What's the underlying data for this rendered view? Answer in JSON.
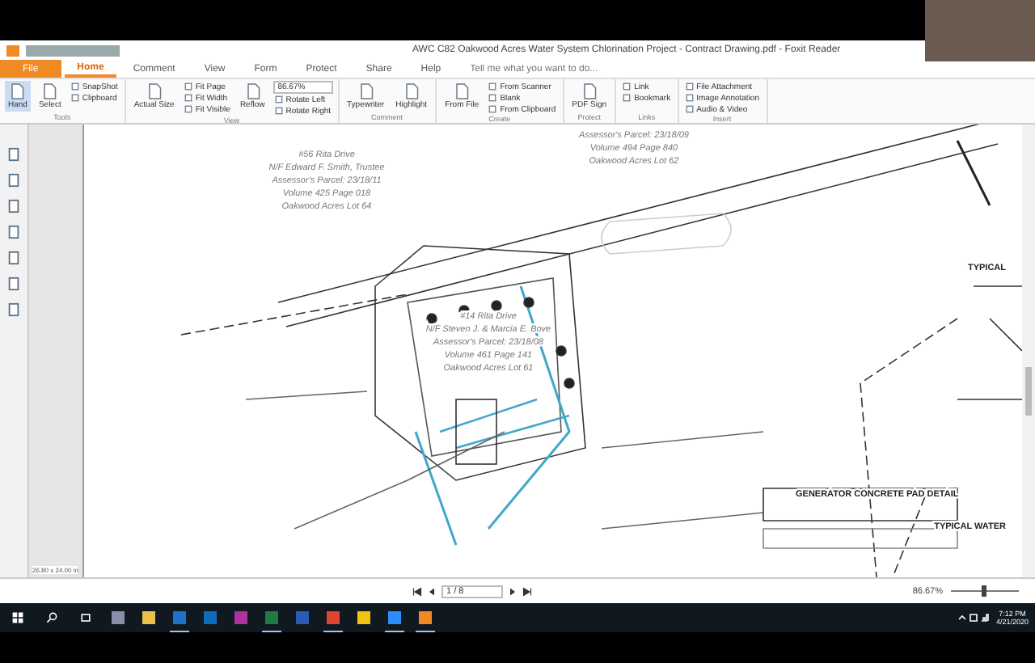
{
  "window": {
    "title": "AWC C82 Oakwood Acres Water System Chlorination Project - Contract Drawing.pdf - Foxit Reader"
  },
  "tabs": [
    {
      "label": "File",
      "selected": false,
      "kind": "file"
    },
    {
      "label": "Home",
      "selected": true,
      "kind": "tab"
    },
    {
      "label": "Comment",
      "selected": false,
      "kind": "tab"
    },
    {
      "label": "View",
      "selected": false,
      "kind": "tab"
    },
    {
      "label": "Form",
      "selected": false,
      "kind": "tab"
    },
    {
      "label": "Protect",
      "selected": false,
      "kind": "tab"
    },
    {
      "label": "Share",
      "selected": false,
      "kind": "tab"
    },
    {
      "label": "Help",
      "selected": false,
      "kind": "tab"
    }
  ],
  "search": {
    "placeholder": "Tell me what you want to do..."
  },
  "ribbon": [
    {
      "label": "Tools",
      "items": [
        {
          "kind": "large",
          "label": "Hand",
          "selected": true
        },
        {
          "kind": "large",
          "label": "Select",
          "selected": false
        },
        {
          "kind": "stack",
          "labels": [
            "SnapShot",
            "Clipboard"
          ]
        }
      ]
    },
    {
      "label": "View",
      "items": [
        {
          "kind": "large",
          "label": "Actual Size",
          "selected": false
        },
        {
          "kind": "stack",
          "labels": [
            "Fit Page",
            "Fit Width",
            "Fit Visible"
          ]
        },
        {
          "kind": "large",
          "label": "Reflow",
          "selected": false
        },
        {
          "kind": "zoom",
          "value": "86.67%",
          "labels": [
            "Rotate Left",
            "Rotate Right"
          ]
        }
      ]
    },
    {
      "label": "Comment",
      "items": [
        {
          "kind": "large",
          "label": "Typewriter",
          "selected": false
        },
        {
          "kind": "large",
          "label": "Highlight",
          "selected": false
        }
      ]
    },
    {
      "label": "Create",
      "items": [
        {
          "kind": "large",
          "label": "From File",
          "selected": false
        },
        {
          "kind": "stack",
          "labels": [
            "From Scanner",
            "Blank",
            "From Clipboard"
          ]
        }
      ]
    },
    {
      "label": "Protect",
      "items": [
        {
          "kind": "large",
          "label": "PDF Sign",
          "selected": false
        }
      ]
    },
    {
      "label": "Links",
      "items": [
        {
          "kind": "stack",
          "labels": [
            "Link",
            "Bookmark"
          ]
        }
      ]
    },
    {
      "label": "Insert",
      "items": [
        {
          "kind": "stack",
          "labels": [
            "File Attachment",
            "Image Annotation",
            "Audio & Video"
          ]
        }
      ]
    }
  ],
  "drawing_labels": [
    {
      "lines": [
        "#56 Rita Drive",
        "N/F Edward F. Smith, Trustee",
        "Assessor's Parcel: 23/18/11",
        "Volume 425 Page 018",
        "Oakwood Acres Lot 64"
      ]
    },
    {
      "lines": [
        "Assessor's Parcel: 23/18/09",
        "Volume 494 Page 840",
        "Oakwood Acres Lot 62"
      ]
    },
    {
      "lines": [
        "#14 Rita Drive",
        "N/F Steven J. & Marcia E. Bove",
        "Assessor's Parcel: 23/18/08",
        "Volume 461 Page 141",
        "Oakwood Acres Lot 61"
      ]
    },
    {
      "lines": [
        "GENERATOR CONCRETE PAD DETAIL"
      ]
    },
    {
      "lines": [
        "TYPICAL"
      ]
    },
    {
      "lines": [
        "TYPICAL WATER"
      ]
    }
  ],
  "page_size": "26.80 x 24.00 in",
  "status_bar": {
    "page": "1 / 8",
    "zoom": "86.67%",
    "zoom_level": {
      "level": 0.45
    }
  },
  "taskbar": {
    "apps": [
      {
        "color": "#8a8fa8",
        "running": false
      },
      {
        "color": "#e8c24a",
        "running": false
      },
      {
        "color": "#1e73c8",
        "running": true
      },
      {
        "color": "#0f6cbd",
        "running": false
      },
      {
        "color": "#b1309f",
        "running": false
      },
      {
        "color": "#1f7a44",
        "running": true
      },
      {
        "color": "#2b5bb3",
        "running": false
      },
      {
        "color": "#e0452f",
        "running": true
      },
      {
        "color": "#f1c40f",
        "running": false
      },
      {
        "color": "#2d8cff",
        "running": true
      },
      {
        "color": "#f08a24",
        "running": true
      }
    ],
    "time": "7:12 PM",
    "date": "4/21/2020"
  }
}
